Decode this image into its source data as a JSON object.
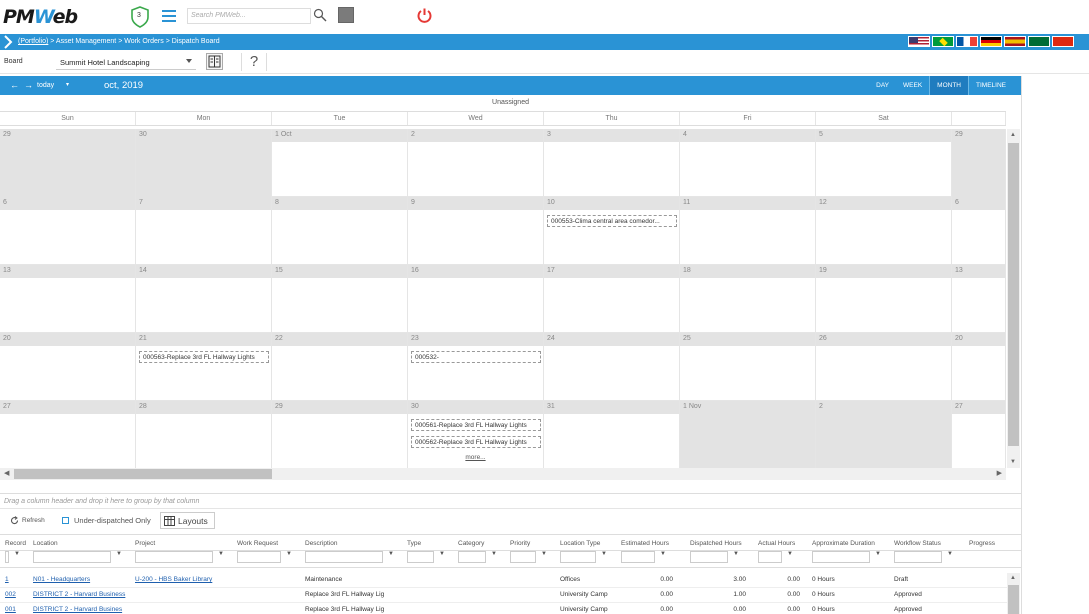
{
  "app": {
    "logo_left": "PM",
    "logo_mid": "W",
    "logo_right": "eb",
    "shield_count": "3",
    "search_placeholder": "Search PMWeb..."
  },
  "breadcrumb": {
    "root": "(Portfolio)",
    "path": " > Asset Management > Work Orders > Dispatch Board"
  },
  "board": {
    "label": "Board",
    "value": "Summit Hotel Landscaping",
    "help": "?"
  },
  "calendar": {
    "today_label": "today",
    "title": "oct, 2019",
    "views": [
      "DAY",
      "WEEK",
      "MONTH",
      "TIMELINE"
    ],
    "active_view": "MONTH",
    "unassigned_label": "Unassigned",
    "days": [
      "Sun",
      "Mon",
      "Tue",
      "Wed",
      "Thu",
      "Fri",
      "Sat",
      ""
    ],
    "weeks": [
      {
        "nums": [
          "29",
          "30",
          "1 Oct",
          "2",
          "3",
          "4",
          "5",
          "29"
        ],
        "other": [
          true,
          true,
          false,
          false,
          false,
          false,
          false,
          true
        ]
      },
      {
        "nums": [
          "6",
          "7",
          "8",
          "9",
          "10",
          "11",
          "12",
          "6"
        ],
        "other": [
          false,
          false,
          false,
          false,
          false,
          false,
          false,
          false
        ]
      },
      {
        "nums": [
          "13",
          "14",
          "15",
          "16",
          "17",
          "18",
          "19",
          "13"
        ],
        "other": [
          false,
          false,
          false,
          false,
          false,
          false,
          false,
          false
        ]
      },
      {
        "nums": [
          "20",
          "21",
          "22",
          "23",
          "24",
          "25",
          "26",
          "20"
        ],
        "other": [
          false,
          false,
          false,
          false,
          false,
          false,
          false,
          false
        ]
      },
      {
        "nums": [
          "27",
          "28",
          "29",
          "30",
          "31",
          "1 Nov",
          "2",
          "27"
        ],
        "other": [
          false,
          false,
          false,
          false,
          false,
          true,
          true,
          false
        ]
      }
    ],
    "events": [
      {
        "week": 1,
        "day": 4,
        "slot": 0,
        "text": "000553-Clima central area comedor..."
      },
      {
        "week": 3,
        "day": 1,
        "slot": 0,
        "text": "000563-Replace 3rd FL Hallway Lights"
      },
      {
        "week": 3,
        "day": 3,
        "slot": 0,
        "text": "000532-"
      },
      {
        "week": 4,
        "day": 3,
        "slot": 0,
        "text": "000561-Replace 3rd FL Hallway Lights"
      },
      {
        "week": 4,
        "day": 3,
        "slot": 1,
        "text": "000562-Replace 3rd FL Hallway Lights"
      }
    ],
    "more_label": "more..."
  },
  "grid": {
    "groupby_hint": "Drag a column header and drop it here to group by that column",
    "refresh_label": "Refresh",
    "underdispatched_label": "Under-dispatched Only",
    "layouts_label": "Layouts",
    "columns": [
      "Record",
      "Location",
      "Project",
      "Work Request",
      "Description",
      "Type",
      "Category",
      "Priority",
      "Location Type",
      "Estimated Hours",
      "Dispatched Hours",
      "Actual Hours",
      "Approximate Duration",
      "Workflow Status",
      "Progress"
    ],
    "rows": [
      [
        "1",
        "N01 - Headquarters",
        "U-200 - HBS Baker Library",
        "",
        "Maintenance",
        "",
        "",
        "",
        "Offices",
        "0.00",
        "3.00",
        "0.00",
        "0 Hours",
        "Draft",
        ""
      ],
      [
        "002",
        "DISTRICT 2 - Harvard Business",
        "",
        "",
        "Replace 3rd FL Hallway Lig",
        "",
        "",
        "",
        "University Camp",
        "0.00",
        "1.00",
        "0.00",
        "0 Hours",
        "Approved",
        ""
      ],
      [
        "001",
        "DISTRICT 2 - Harvard Busines",
        "",
        "",
        "Replace 3rd FL Hallway Lig",
        "",
        "",
        "",
        "University Camp",
        "0.00",
        "0.00",
        "0.00",
        "0 Hours",
        "Approved",
        ""
      ]
    ]
  },
  "colors": {
    "accent": "#2a93d5",
    "link": "#1e5fae",
    "power": "#e53935"
  }
}
